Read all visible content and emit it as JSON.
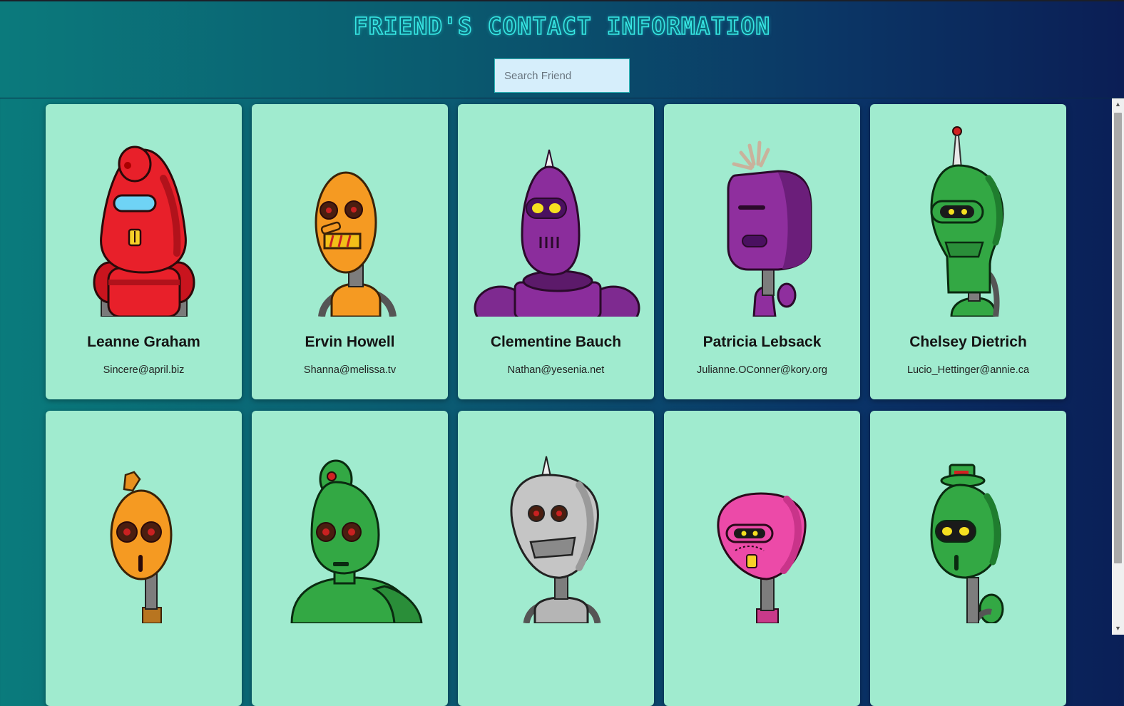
{
  "header": {
    "title": "FRIEND'S CONTACT INFORMATION",
    "search_placeholder": "Search Friend"
  },
  "cards": [
    {
      "name": "Leanne Graham",
      "email": "Sincere@april.biz",
      "robot": "red-robot",
      "color": "#e8202a"
    },
    {
      "name": "Ervin Howell",
      "email": "Shanna@melissa.tv",
      "robot": "orange-robot",
      "color": "#f59a22"
    },
    {
      "name": "Clementine Bauch",
      "email": "Nathan@yesenia.net",
      "robot": "purple-robot",
      "color": "#8b2d9c"
    },
    {
      "name": "Patricia Lebsack",
      "email": "Julianne.OConner@kory.org",
      "robot": "purple-robot",
      "color": "#8f2f9e"
    },
    {
      "name": "Chelsey Dietrich",
      "email": "Lucio_Hettinger@annie.ca",
      "robot": "green-robot",
      "color": "#33a844"
    },
    {
      "name": "",
      "email": "",
      "robot": "orange-robot",
      "color": "#f59a22"
    },
    {
      "name": "",
      "email": "",
      "robot": "green-robot",
      "color": "#36ad45"
    },
    {
      "name": "",
      "email": "",
      "robot": "gray-robot",
      "color": "#b5b5b5"
    },
    {
      "name": "",
      "email": "",
      "robot": "pink-robot",
      "color": "#ec4aa8"
    },
    {
      "name": "",
      "email": "",
      "robot": "green-robot",
      "color": "#33a844"
    }
  ],
  "colors": {
    "card_bg": "#a0ebcf",
    "title_glow": "#37e6e3",
    "search_bg": "#d6eefb"
  }
}
